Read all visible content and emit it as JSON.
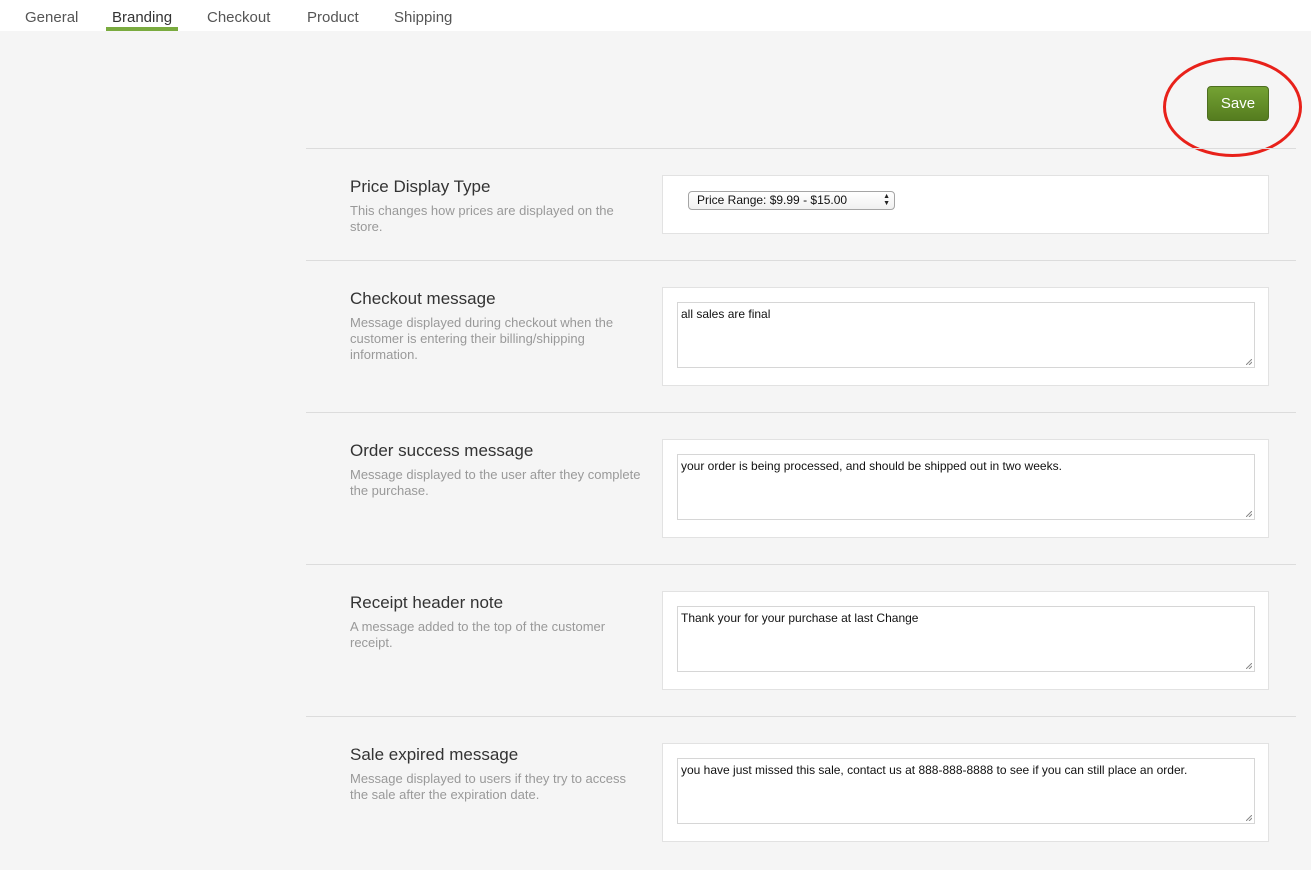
{
  "tabs": [
    {
      "label": "General"
    },
    {
      "label": "Branding",
      "active": true
    },
    {
      "label": "Checkout"
    },
    {
      "label": "Product"
    },
    {
      "label": "Shipping"
    }
  ],
  "colors": {
    "accent": "#7aab3f",
    "save_button": "#5f8a25",
    "annotation": "#e8211a"
  },
  "toolbar": {
    "save_label": "Save"
  },
  "settings": {
    "price_display": {
      "label": "Price Display Type",
      "description": "This changes how prices are displayed on the store.",
      "selected": "Price Range: $9.99 - $15.00"
    },
    "checkout_message": {
      "label": "Checkout message",
      "description": "Message displayed during checkout when the customer is entering their billing/shipping information.",
      "value": "all sales are final"
    },
    "order_success": {
      "label": "Order success message",
      "description": "Message displayed to the user after they complete the purchase.",
      "value": "your order is being processed, and should be shipped out in two weeks."
    },
    "receipt_header": {
      "label": "Receipt header note",
      "description": "A message added to the top of the customer receipt.",
      "value": "Thank your for your purchase at last Change"
    },
    "sale_expired": {
      "label": "Sale expired message",
      "description": "Message displayed to users if they try to access the sale after the expiration date.",
      "value": "you have just missed this sale, contact us at 888-888-8888 to see if you can still place an order."
    }
  }
}
